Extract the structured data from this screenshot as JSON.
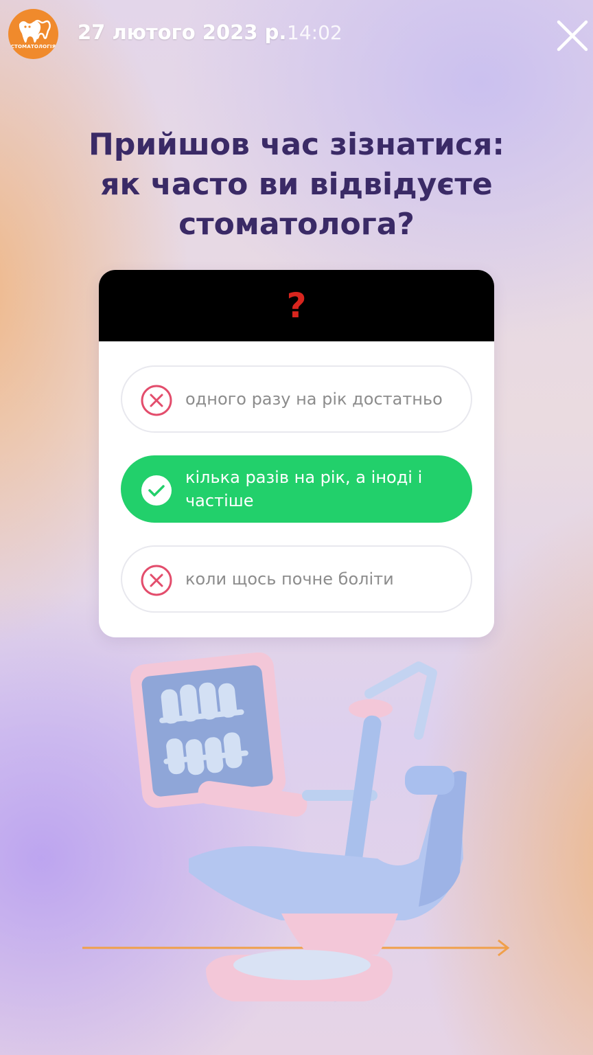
{
  "header": {
    "avatar_label": "СТОМАТОЛОГІЯ",
    "date": "27 лютого 2023 р.",
    "time": "14:02"
  },
  "title_lines": [
    "Прийшов час зізнатися:",
    "як часто ви відвідуєте",
    "стоматолога?"
  ],
  "quiz": {
    "prompt_symbol": "?",
    "options": [
      {
        "label": "одного разу на рік достатньо",
        "correct": false
      },
      {
        "label": "кілька разів на рік, а іноді і частіше",
        "correct": true
      },
      {
        "label": "коли щось почне боліти",
        "correct": false
      }
    ]
  },
  "colors": {
    "accent_green": "#22d06b",
    "wrong_red": "#e34d6c",
    "title": "#3a2a66",
    "brand_orange": "#f08a2c"
  }
}
